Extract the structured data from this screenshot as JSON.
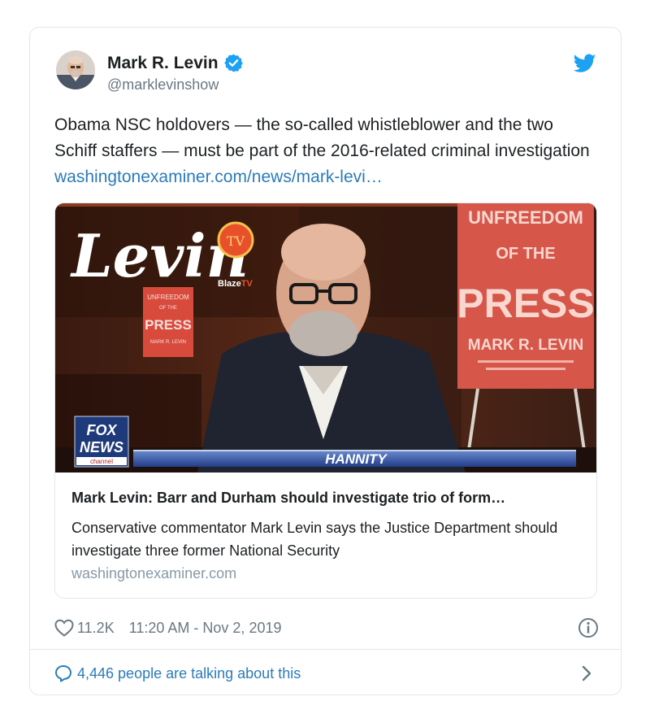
{
  "author": {
    "name": "Mark R. Levin",
    "handle": "@marklevinshow",
    "verified": true
  },
  "tweet": {
    "text": "Obama NSC holdovers — the so-called whistleblower and the two Schiff staffers — must be part of the 2016-related criminal investigation ",
    "link_text": "washingtonexaminer.com/news/mark-levi…"
  },
  "card": {
    "image_texts": {
      "show_logo": "Levin",
      "network_badge": "TV",
      "blaze_label": "Blaze",
      "blaze_suffix": "TV",
      "book_title_1": "UNFREEDOM",
      "book_title_2": "OF THE",
      "book_title_3": "PRESS",
      "book_author": "MARK R. LEVIN",
      "small_book_1": "UNFREEDOM",
      "small_book_2": "OF THE",
      "small_book_3": "PRESS",
      "small_book_4": "MARK R. LEVIN",
      "fox_line1": "FOX",
      "fox_line2": "NEWS",
      "fox_line3": "channel",
      "ticker_label": "HANNITY"
    },
    "title": "Mark Levin: Barr and Durham should investigate trio of form…",
    "description": "Conservative commentator Mark Levin says the Justice Department should investigate three former National Security",
    "domain": "washingtonexaminer.com"
  },
  "meta": {
    "likes": "11.2K",
    "timestamp": "11:20 AM - Nov 2, 2019"
  },
  "footer": {
    "talking": "4,446 people are talking about this"
  },
  "colors": {
    "link": "#2b7bb9",
    "verified": "#1da1f2",
    "twitter_brand": "#1da1f2",
    "muted": "#697882",
    "border": "#e1e8ed"
  },
  "icons": [
    "verified-badge-icon",
    "twitter-bird-icon",
    "heart-icon",
    "info-icon",
    "comment-icon",
    "chevron-right-icon"
  ]
}
